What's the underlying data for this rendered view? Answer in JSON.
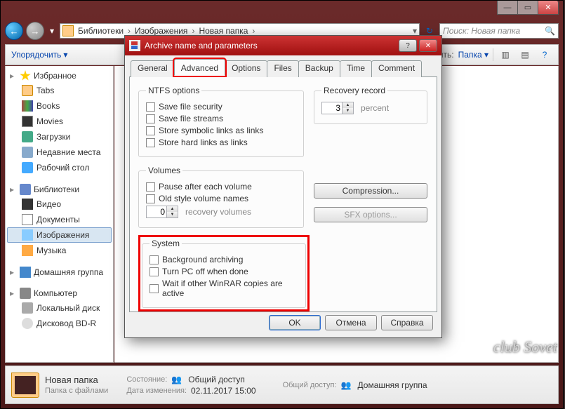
{
  "titlebar": {
    "min": "—",
    "max": "▭",
    "close": "✕"
  },
  "nav": {
    "back": "←",
    "fwd": "→",
    "drop": "▾",
    "crumbs": [
      "Библиотеки",
      "Изображения",
      "Новая папка"
    ],
    "sep": "›",
    "refresh": "↻",
    "search_placeholder": "Поиск: Новая папка",
    "search_icon": "🔍"
  },
  "toolbar": {
    "organize": "Упорядочить",
    "drop": "▾",
    "sort_label": "Упорядочить:",
    "sort_value": "Папка",
    "view_icon": "▥",
    "preview_icon": "▤",
    "help_icon": "?"
  },
  "sidebar": {
    "favorites": {
      "title": "Избранное",
      "items": [
        "Tabs",
        "Books",
        "Movies",
        "Загрузки",
        "Недавние места",
        "Рабочий стол"
      ]
    },
    "libraries": {
      "title": "Библиотеки",
      "items": [
        "Видео",
        "Документы",
        "Изображения",
        "Музыка"
      ]
    },
    "homegroup": {
      "title": "Домашняя группа"
    },
    "computer": {
      "title": "Компьютер",
      "items": [
        "Локальный диск",
        "Дисковод BD-R"
      ]
    }
  },
  "statusbar": {
    "folder_name": "Новая папка",
    "folder_sub": "Папка с файлами",
    "state_label": "Состояние:",
    "state_value": "Общий доступ",
    "date_label": "Дата изменения:",
    "date_value": "02.11.2017 15:00",
    "access_label": "Общий доступ:",
    "access_value": "Домашняя группа"
  },
  "dialog": {
    "title": "Archive name and parameters",
    "help": "?",
    "close": "✕",
    "tabs": [
      "General",
      "Advanced",
      "Options",
      "Files",
      "Backup",
      "Time",
      "Comment"
    ],
    "ntfs": {
      "legend": "NTFS options",
      "opts": [
        "Save file security",
        "Save file streams",
        "Store symbolic links as links",
        "Store hard links as links"
      ]
    },
    "recovery": {
      "legend": "Recovery record",
      "value": "3",
      "unit": "percent"
    },
    "volumes": {
      "legend": "Volumes",
      "opts": [
        "Pause after each volume",
        "Old style volume names"
      ],
      "spin_value": "0",
      "spin_unit": "recovery volumes"
    },
    "buttons_right": {
      "compression": "Compression...",
      "sfx": "SFX options..."
    },
    "system": {
      "legend": "System",
      "opts": [
        "Background archiving",
        "Turn PC off when done",
        "Wait if other WinRAR copies are active"
      ]
    },
    "buttons": {
      "ok": "OK",
      "cancel": "Отмена",
      "help": "Справка"
    }
  },
  "watermark": "club Sovet"
}
